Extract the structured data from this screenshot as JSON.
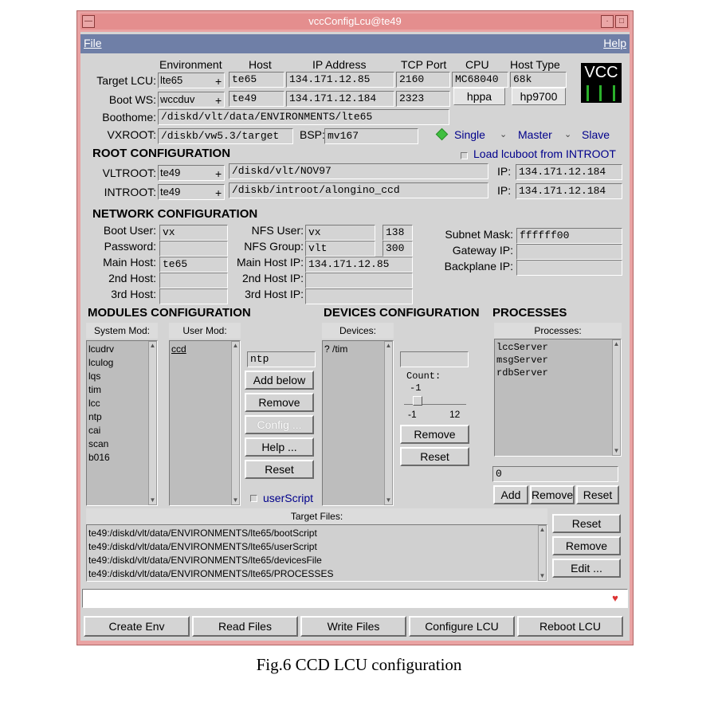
{
  "window": {
    "title": "vccConfigLcu@te49"
  },
  "menu": {
    "file": "File",
    "help": "Help"
  },
  "headers": {
    "environment": "Environment",
    "host": "Host",
    "ip": "IP Address",
    "tcp": "TCP Port",
    "cpu": "CPU",
    "hosttype": "Host Type"
  },
  "target": {
    "label": "Target LCU:",
    "env": "lte65",
    "host": "te65",
    "ip": "134.171.12.85",
    "port": "2160",
    "cpu": "MC68040",
    "type": "68k"
  },
  "boot": {
    "label": "Boot WS:",
    "env": "wccduv",
    "host": "te49",
    "ip": "134.171.12.184",
    "port": "2323",
    "cpu": "hppa",
    "type": "hp9700"
  },
  "boothome": {
    "label": "Boothome:",
    "value": "/diskd/vlt/data/ENVIRONMENTS/lte65"
  },
  "vxroot": {
    "label": "VXROOT:",
    "value": "/diskb/vw5.3/target",
    "bsp_label": "BSP:",
    "bsp": "mv167"
  },
  "mode": {
    "single": "Single",
    "master": "Master",
    "slave": "Slave"
  },
  "root": {
    "heading": "ROOT CONFIGURATION",
    "load": "Load lcuboot from INTROOT",
    "vltroot_label": "VLTROOT:",
    "vltroot_env": "te49",
    "vltroot_path": "/diskd/vlt/NOV97",
    "ip_label": "IP:",
    "vltroot_ip": "134.171.12.184",
    "introot_label": "INTROOT:",
    "introot_env": "te49",
    "introot_path": "/diskb/introot/alongino_ccd",
    "introot_ip": "134.171.12.184"
  },
  "network": {
    "heading": "NETWORK CONFIGURATION",
    "boot_user_label": "Boot User:",
    "boot_user": "vx",
    "password_label": "Password:",
    "main_host_label": "Main Host:",
    "main_host": "te65",
    "host2_label": "2nd Host:",
    "host3_label": "3rd Host:",
    "nfs_user_label": "NFS User:",
    "nfs_user": "vx",
    "nfs_uid": "138",
    "nfs_group_label": "NFS Group:",
    "nfs_group": "vlt",
    "nfs_gid": "300",
    "main_ip_label": "Main Host IP:",
    "main_ip": "134.171.12.85",
    "ip2_label": "2nd Host IP:",
    "ip3_label": "3rd Host IP:",
    "subnet_label": "Subnet Mask:",
    "subnet": "ffffff00",
    "gateway_label": "Gateway IP:",
    "backplane_label": "Backplane IP:"
  },
  "modules": {
    "heading": "MODULES CONFIGURATION",
    "system_header": "System Mod:",
    "system_items": [
      "lcudrv",
      "lculog",
      "lqs",
      "tim",
      "lcc",
      "ntp",
      "cai",
      "scan",
      "b016"
    ],
    "user_header": "User Mod:",
    "user_items": [
      "ccd"
    ],
    "entry": "ntp",
    "add": "Add below",
    "remove": "Remove",
    "config": "Config ...",
    "help": "Help ...",
    "reset": "Reset",
    "userscript": "userScript"
  },
  "devices": {
    "heading": "DEVICES CONFIGURATION",
    "header": "Devices:",
    "items": [
      "? /tim"
    ],
    "count_label": "Count:",
    "count_value": "-1",
    "min": "-1",
    "max": "12",
    "remove": "Remove",
    "reset": "Reset"
  },
  "processes": {
    "heading": "PROCESSES",
    "header": "Processes:",
    "items": [
      "lccServer",
      "msgServer",
      "rdbServer"
    ],
    "entry": "0",
    "add": "Add",
    "remove": "Remove",
    "reset": "Reset"
  },
  "target_files": {
    "header": "Target Files:",
    "items": [
      "te49:/diskd/vlt/data/ENVIRONMENTS/lte65/bootScript",
      "te49:/diskd/vlt/data/ENVIRONMENTS/lte65/userScript",
      "te49:/diskd/vlt/data/ENVIRONMENTS/lte65/devicesFile",
      "te49:/diskd/vlt/data/ENVIRONMENTS/lte65/PROCESSES"
    ],
    "reset": "Reset",
    "remove": "Remove",
    "edit": "Edit ..."
  },
  "bottom": {
    "create": "Create Env",
    "read": "Read Files",
    "write": "Write Files",
    "configure": "Configure LCU",
    "reboot": "Reboot LCU"
  },
  "logo": "VCC",
  "plus": "+",
  "caption": "Fig.6 CCD LCU configuration"
}
